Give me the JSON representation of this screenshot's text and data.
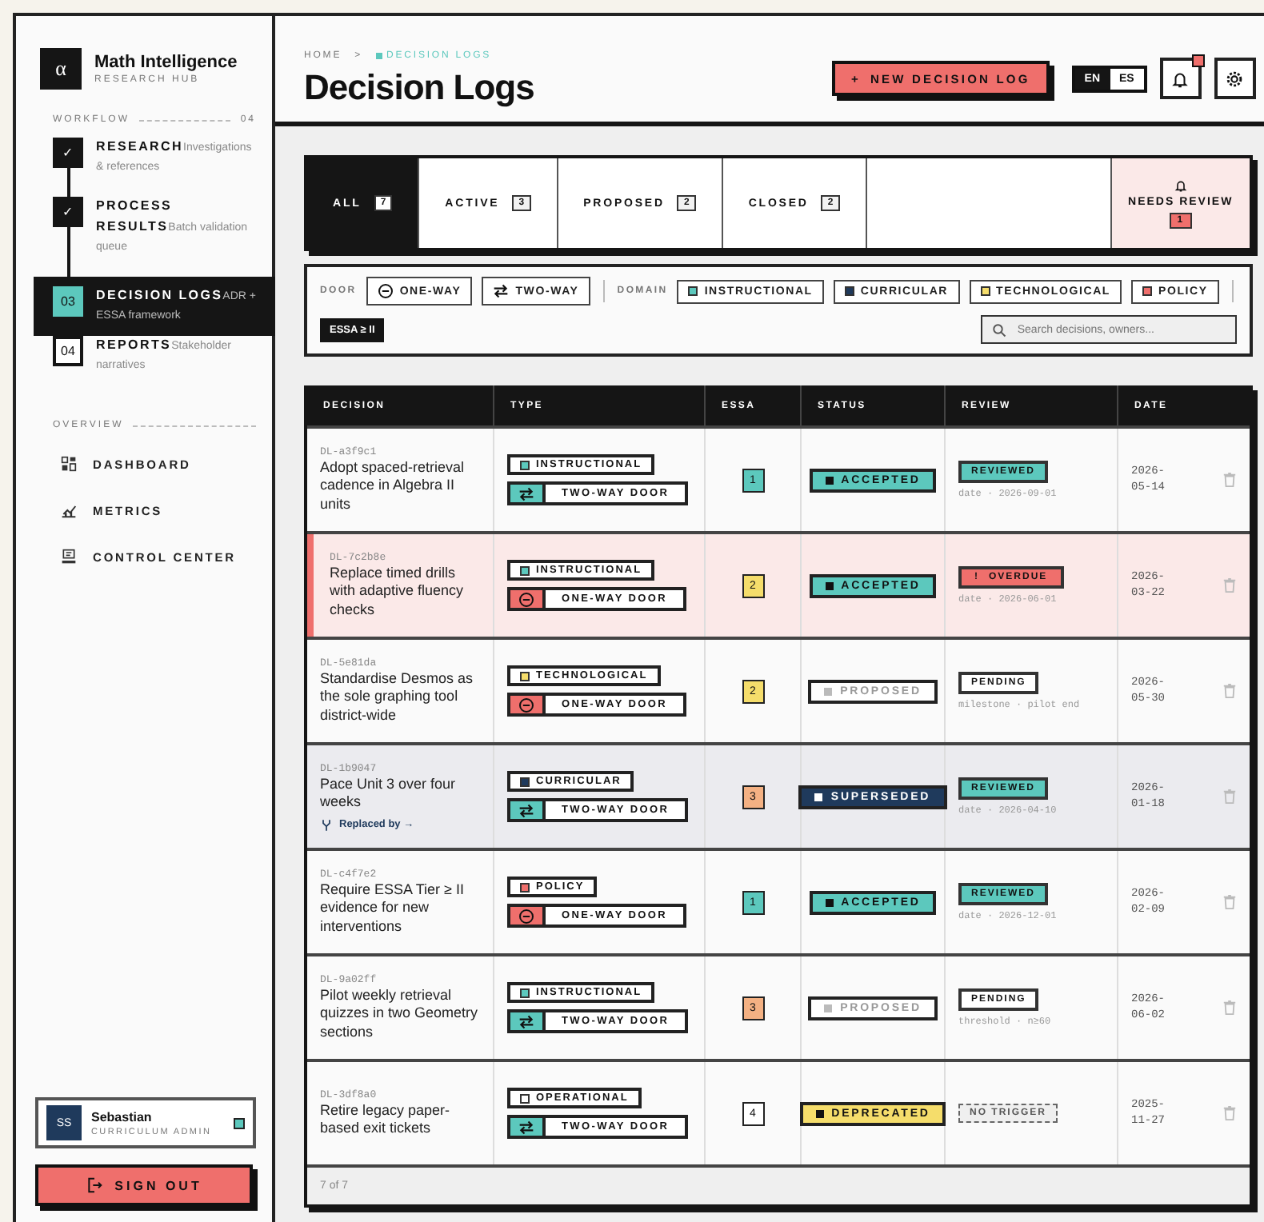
{
  "brand": {
    "logo": "α",
    "name": "Math Intelligence",
    "subtitle": "RESEARCH HUB"
  },
  "workflow": {
    "label": "WORKFLOW",
    "count": "04",
    "steps": [
      {
        "marker": "✓",
        "completed": true,
        "selected": false,
        "title": "RESEARCH",
        "description": "Investigations & references"
      },
      {
        "marker": "✓",
        "completed": true,
        "selected": false,
        "title": "PROCESS RESULTS",
        "description": "Batch validation queue"
      },
      {
        "marker": "03",
        "completed": false,
        "selected": true,
        "title": "DECISION LOGS",
        "description": "ADR + ESSA framework"
      },
      {
        "marker": "04",
        "completed": false,
        "selected": false,
        "title": "REPORTS",
        "description": "Stakeholder narratives"
      }
    ]
  },
  "overview": {
    "label": "OVERVIEW",
    "items": [
      {
        "label": "DASHBOARD"
      },
      {
        "label": "METRICS"
      },
      {
        "label": "CONTROL CENTER"
      }
    ]
  },
  "user": {
    "initials": "SS",
    "name": "Sebastian",
    "role": "CURRICULUM ADMIN",
    "online": true
  },
  "sign_out": "SIGN OUT",
  "breadcrumb": {
    "items": [
      "HOME",
      "DECISION LOGS"
    ],
    "separator": ">"
  },
  "title": "Decision Logs",
  "new_button": {
    "icon": "+",
    "label": "NEW DECISION LOG"
  },
  "languages": [
    {
      "label": "EN",
      "selected": true
    },
    {
      "label": "ES",
      "selected": false
    }
  ],
  "notifications": {
    "unread": true
  },
  "tabs": [
    {
      "label": "ALL",
      "count": "7",
      "selected": true
    },
    {
      "label": "ACTIVE",
      "count": "3",
      "selected": false
    },
    {
      "label": "PROPOSED",
      "count": "2",
      "selected": false
    },
    {
      "label": "CLOSED",
      "count": "2",
      "selected": false
    }
  ],
  "needs_review": {
    "label": "NEEDS REVIEW",
    "count": "1"
  },
  "filters": {
    "door_label": "DOOR",
    "doors": [
      {
        "kind": "one-way",
        "label": "ONE-WAY"
      },
      {
        "kind": "two-way",
        "label": "TWO-WAY"
      }
    ],
    "domain_label": "DOMAIN",
    "domains": [
      {
        "label": "INSTRUCTIONAL",
        "color": "#5cc8bd"
      },
      {
        "label": "CURRICULAR",
        "color": "#1f3a5c"
      },
      {
        "label": "TECHNOLOGICAL",
        "color": "#f5dd6b"
      },
      {
        "label": "POLICY",
        "color": "#ef6f6c"
      }
    ],
    "essa": {
      "label": "ESSA ≥ II",
      "selected": true
    },
    "search": {
      "placeholder": "Search decisions, owners..."
    }
  },
  "table": {
    "columns": [
      "DECISION",
      "TYPE",
      "ESSA",
      "STATUS",
      "REVIEW",
      "DATE"
    ],
    "rows": [
      {
        "id": "DL-a3f9c1",
        "title": "Adopt spaced-retrieval cadence in Algebra II units",
        "flagged": false,
        "dimmed": false,
        "domain": {
          "label": "INSTRUCTIONAL",
          "color": "#5cc8bd"
        },
        "door": {
          "kind": "two-way",
          "label": "TWO-WAY DOOR"
        },
        "essa": {
          "value": "1",
          "color": "#5cc8bd"
        },
        "status": {
          "kind": "accepted",
          "label": "ACCEPTED"
        },
        "review": {
          "kind": "reviewed",
          "label": "REVIEWED",
          "detail": "date · 2026-09-01"
        },
        "date": "2026-05-14"
      },
      {
        "id": "DL-7c2b8e",
        "title": "Replace timed drills with adaptive fluency checks",
        "flagged": true,
        "dimmed": false,
        "domain": {
          "label": "INSTRUCTIONAL",
          "color": "#5cc8bd"
        },
        "door": {
          "kind": "one-way",
          "label": "ONE-WAY DOOR"
        },
        "essa": {
          "value": "2",
          "color": "#f5dd6b"
        },
        "status": {
          "kind": "accepted",
          "label": "ACCEPTED"
        },
        "review": {
          "kind": "overdue",
          "symbol": "!",
          "label": "OVERDUE",
          "detail": "date · 2026-06-01"
        },
        "date": "2026-03-22"
      },
      {
        "id": "DL-5e81da",
        "title": "Standardise Desmos as the sole graphing tool district-wide",
        "flagged": false,
        "dimmed": false,
        "domain": {
          "label": "TECHNOLOGICAL",
          "color": "#f5dd6b"
        },
        "door": {
          "kind": "one-way",
          "label": "ONE-WAY DOOR"
        },
        "essa": {
          "value": "2",
          "color": "#f5dd6b"
        },
        "status": {
          "kind": "proposed",
          "label": "PROPOSED"
        },
        "review": {
          "kind": "pending",
          "label": "PENDING",
          "detail": "milestone · pilot end"
        },
        "date": "2026-05-30"
      },
      {
        "id": "DL-1b9047",
        "title": "Pace Unit 3 over four weeks",
        "replaced_by": "Replaced by →",
        "flagged": false,
        "dimmed": true,
        "domain": {
          "label": "CURRICULAR",
          "color": "#1f3a5c"
        },
        "door": {
          "kind": "two-way",
          "label": "TWO-WAY DOOR"
        },
        "essa": {
          "value": "3",
          "color": "#f4b183"
        },
        "status": {
          "kind": "superseded",
          "label": "SUPERSEDED"
        },
        "review": {
          "kind": "reviewed",
          "label": "REVIEWED",
          "detail": "date · 2026-04-10"
        },
        "date": "2026-01-18"
      },
      {
        "id": "DL-c4f7e2",
        "title": "Require ESSA Tier ≥ II evidence for new interventions",
        "flagged": false,
        "dimmed": false,
        "domain": {
          "label": "POLICY",
          "color": "#ef6f6c"
        },
        "door": {
          "kind": "one-way",
          "label": "ONE-WAY DOOR"
        },
        "essa": {
          "value": "1",
          "color": "#5cc8bd"
        },
        "status": {
          "kind": "accepted",
          "label": "ACCEPTED"
        },
        "review": {
          "kind": "reviewed",
          "label": "REVIEWED",
          "detail": "date · 2026-12-01"
        },
        "date": "2026-02-09"
      },
      {
        "id": "DL-9a02ff",
        "title": "Pilot weekly retrieval quizzes in two Geometry sections",
        "flagged": false,
        "dimmed": false,
        "domain": {
          "label": "INSTRUCTIONAL",
          "color": "#5cc8bd"
        },
        "door": {
          "kind": "two-way",
          "label": "TWO-WAY DOOR"
        },
        "essa": {
          "value": "3",
          "color": "#f4b183"
        },
        "status": {
          "kind": "proposed",
          "label": "PROPOSED"
        },
        "review": {
          "kind": "pending",
          "label": "PENDING",
          "detail": "threshold · n≥60"
        },
        "date": "2026-06-02"
      },
      {
        "id": "DL-3df8a0",
        "title": "Retire legacy paper-based exit tickets",
        "flagged": false,
        "dimmed": false,
        "domain": {
          "label": "OPERATIONAL",
          "color": "#ffffff"
        },
        "door": {
          "kind": "two-way",
          "label": "TWO-WAY DOOR"
        },
        "essa": {
          "value": "4",
          "color": "#ffffff"
        },
        "status": {
          "kind": "deprecated",
          "label": "DEPRECATED"
        },
        "review": {
          "kind": "no-trigger",
          "label": "NO TRIGGER"
        },
        "date": "2025-11-27"
      }
    ],
    "footer": "7 of 7"
  }
}
